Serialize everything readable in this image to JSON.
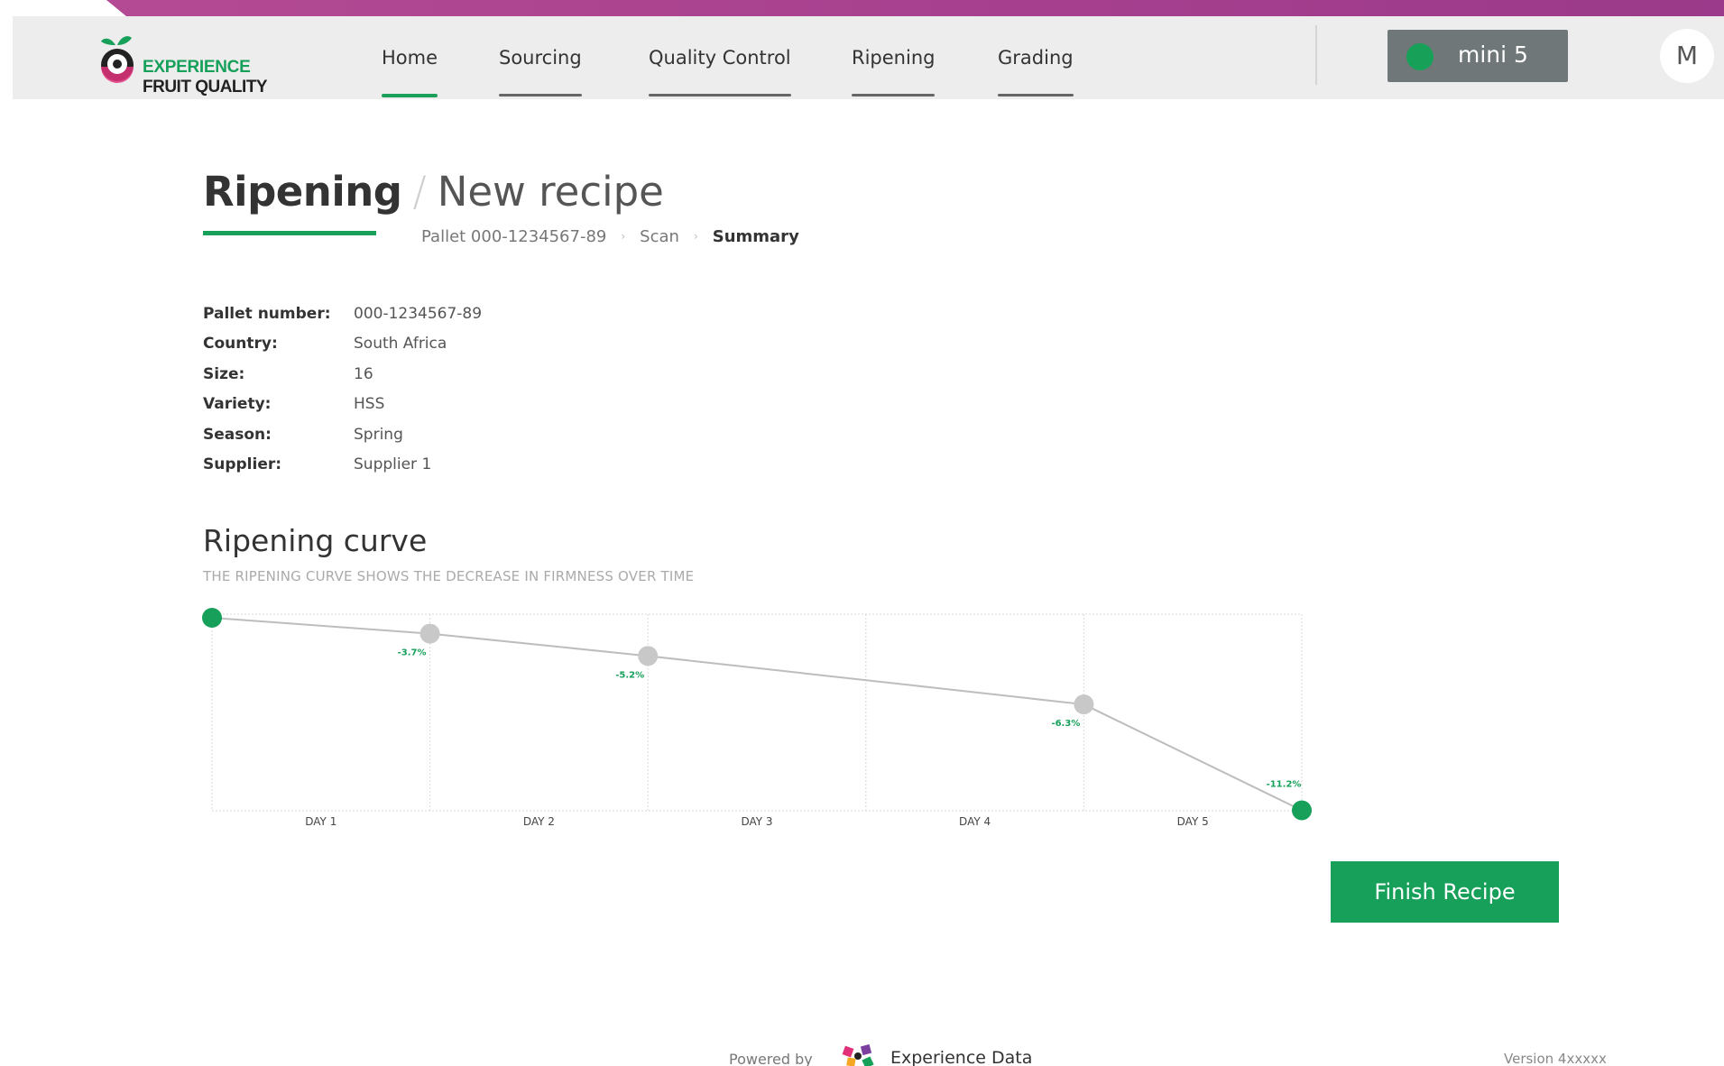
{
  "brand": {
    "line1": "EXPERIENCE",
    "line2": "FRUIT QUALITY"
  },
  "nav": {
    "items": [
      {
        "label": "Home",
        "active": true
      },
      {
        "label": "Sourcing",
        "active": false
      },
      {
        "label": "Quality Control",
        "active": false
      },
      {
        "label": "Ripening",
        "active": false
      },
      {
        "label": "Grading",
        "active": false
      }
    ]
  },
  "device": {
    "label": "mini 5",
    "status_color": "#17a058"
  },
  "user": {
    "initial": "M"
  },
  "page": {
    "title": "Ripening",
    "separator": "/",
    "subtitle": "New recipe",
    "breadcrumb": [
      "Pallet 000-1234567-89",
      "Scan",
      "Summary"
    ]
  },
  "details": [
    {
      "label": "Pallet number:",
      "value": "000-1234567-89"
    },
    {
      "label": "Country:",
      "value": "South Africa"
    },
    {
      "label": "Size:",
      "value": "16"
    },
    {
      "label": "Variety:",
      "value": "HSS"
    },
    {
      "label": "Season:",
      "value": "Spring"
    },
    {
      "label": "Supplier:",
      "value": "Supplier 1"
    }
  ],
  "curve": {
    "title": "Ripening curve",
    "subtitle": "THE RIPENING CURVE SHOWS THE DECREASE IN FIRMNESS OVER TIME"
  },
  "chart_data": {
    "type": "line",
    "categories": [
      "DAY 1",
      "DAY 2",
      "DAY 3",
      "DAY 4",
      "DAY 5"
    ],
    "x": [
      0,
      1,
      2,
      4,
      5
    ],
    "y": [
      100,
      96.3,
      91.1,
      79.8,
      55.1
    ],
    "labels": [
      "",
      "-3.7%",
      "-5.2%",
      "-6.3%",
      "-11.2%"
    ],
    "xlim": [
      0,
      5
    ],
    "ylim": [
      55,
      100
    ],
    "grid": true,
    "accent_color": "#16a05a",
    "point_color": "#c8c8c8"
  },
  "actions": {
    "finish_label": "Finish Recipe"
  },
  "footer": {
    "powered_by": "Powered by",
    "company": "Experience Data",
    "version": "Version 4xxxxx"
  }
}
